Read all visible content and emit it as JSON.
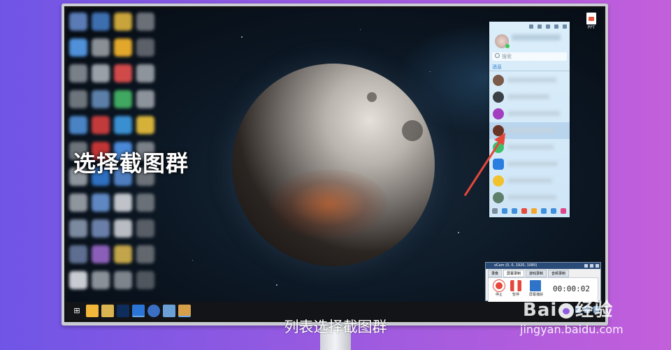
{
  "overlay_heading": "选择截图群",
  "caption": "列表选择截图群",
  "desktop": {
    "ppt_file_label": "PPT"
  },
  "chat_panel": {
    "search_placeholder": "搜索",
    "tab_label": "消息"
  },
  "recorder": {
    "title": "oCam (0, 0, 1920, 1080)",
    "tabs": [
      "录像",
      "屏幕录制",
      "游戏录制",
      "音频录制"
    ],
    "stop_label": "停止",
    "pause_label": "暂停",
    "screen_label": "屏幕捕获",
    "timer": "00:00:02"
  },
  "watermark": {
    "logo_left": "Bai",
    "logo_right": "经验",
    "url": "jingyan.baidu.com"
  },
  "colors": {
    "accent_red": "#e5473b",
    "chat_blue": "#2d7cd1"
  }
}
